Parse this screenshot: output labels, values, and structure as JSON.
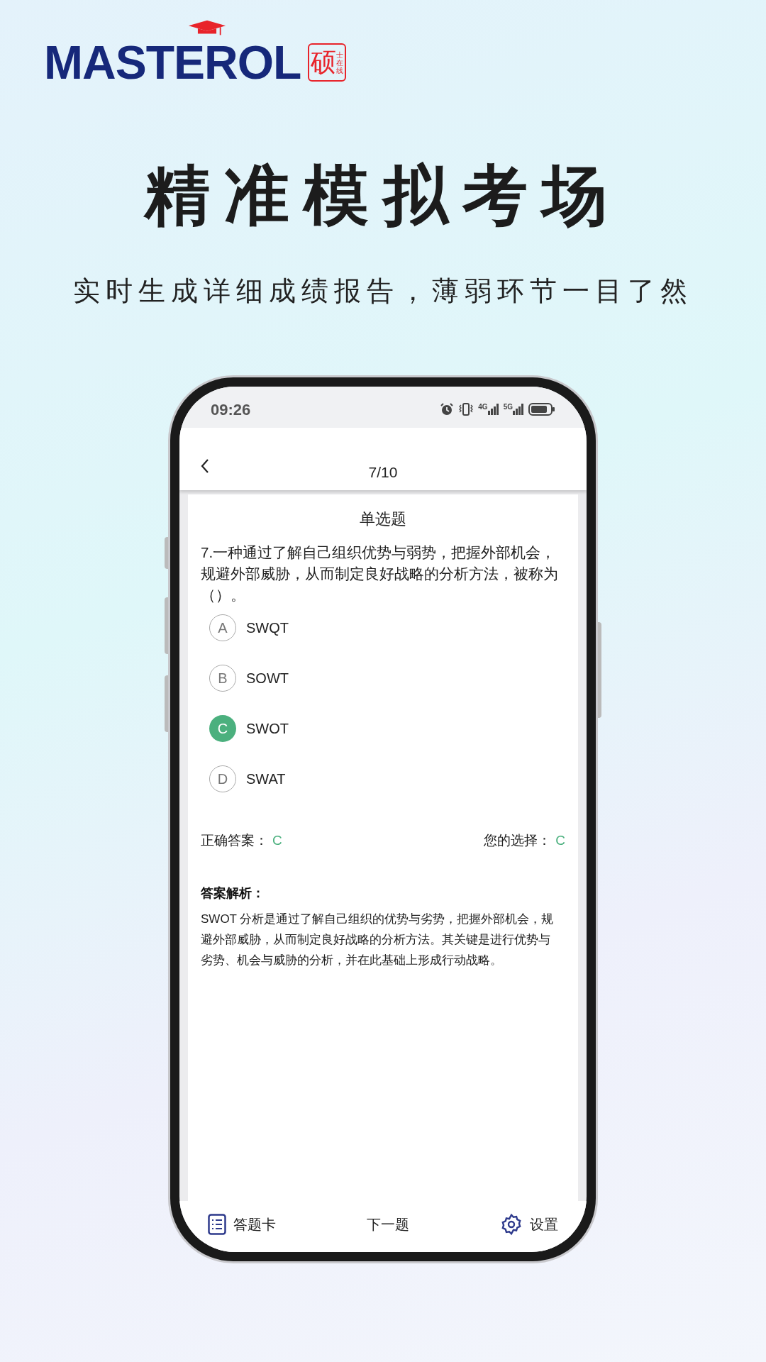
{
  "logo": {
    "wordmark": "MASTEROL",
    "seal_main": "硕",
    "seal_small": "士在线"
  },
  "headline": "精准模拟考场",
  "subtitle": "实时生成详细成绩报告，薄弱环节一目了然",
  "status_bar": {
    "time": "09:26",
    "net_1": "4G",
    "net_2": "5G"
  },
  "nav": {
    "title": "7/10"
  },
  "question": {
    "type": "单选题",
    "text": "7.一种通过了解自己组织优势与弱势，把握外部机会，规避外部威胁，从而制定良好战略的分析方法，被称为（）。",
    "options": [
      {
        "letter": "A",
        "text": "SWQT",
        "selected": false
      },
      {
        "letter": "B",
        "text": "SOWT",
        "selected": false
      },
      {
        "letter": "C",
        "text": "SWOT",
        "selected": true
      },
      {
        "letter": "D",
        "text": "SWAT",
        "selected": false
      }
    ]
  },
  "result": {
    "correct_label": "正确答案：",
    "correct_value": "C",
    "choice_label": "您的选择：",
    "choice_value": "C"
  },
  "analysis": {
    "title": "答案解析：",
    "text": "SWOT 分析是通过了解自己组织的优势与劣势，把握外部机会，规避外部威胁，从而制定良好战略的分析方法。其关键是进行优势与劣势、机会与威胁的分析，并在此基础上形成行动战略。"
  },
  "bottom_bar": [
    {
      "kind": "card",
      "label": "答题卡"
    },
    {
      "kind": "next",
      "label": "下一题"
    },
    {
      "kind": "settings",
      "label": "设置"
    }
  ]
}
